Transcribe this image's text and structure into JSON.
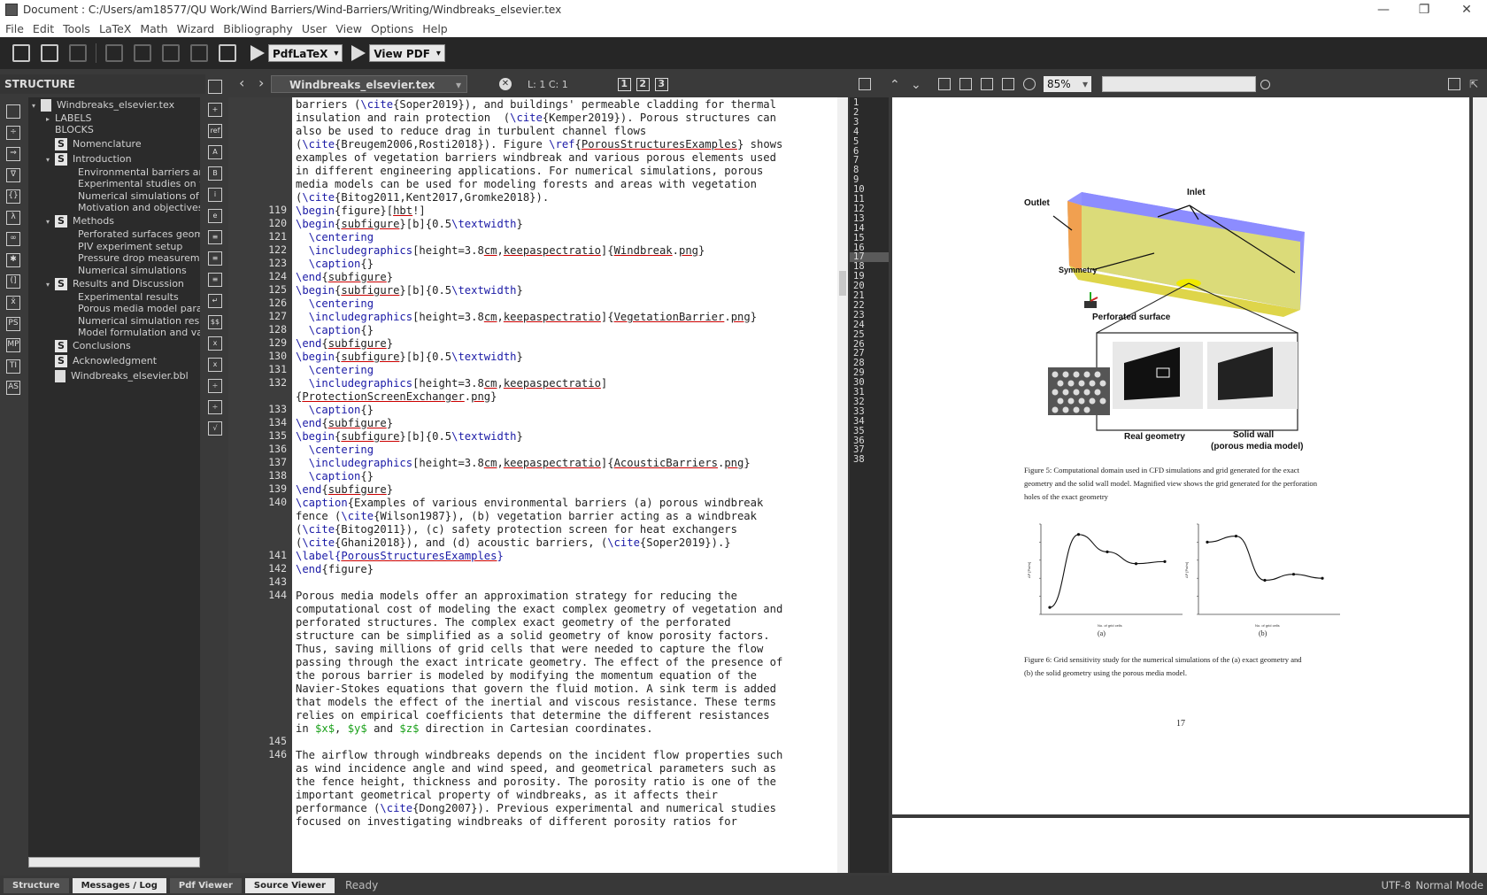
{
  "title_bar": {
    "title": "Document : C:/Users/am18577/QU Work/Wind Barriers/Wind-Barriers/Writing/Windbreaks_elsevier.tex",
    "minimize": "—",
    "maximize": "❐",
    "close": "✕"
  },
  "menu": [
    "File",
    "Edit",
    "Tools",
    "LaTeX",
    "Math",
    "Wizard",
    "Bibliography",
    "User",
    "View",
    "Options",
    "Help"
  ],
  "toolbar": {
    "compiler": "PdfLaTeX",
    "viewer": "View PDF"
  },
  "structure": {
    "header": "STRUCTURE",
    "items": [
      {
        "label": "Windbreaks_elsevier.tex",
        "kind": "file",
        "level": 0,
        "arrow": "▾"
      },
      {
        "label": "LABELS",
        "kind": "plain",
        "level": 1,
        "arrow": "▸"
      },
      {
        "label": "BLOCKS",
        "kind": "plain",
        "level": 1,
        "arrow": ""
      },
      {
        "label": "Nomenclature",
        "kind": "section",
        "level": 1,
        "arrow": ""
      },
      {
        "label": "Introduction",
        "kind": "section",
        "level": 1,
        "arrow": "▾"
      },
      {
        "label": "Environmental barriers and",
        "kind": "sub",
        "level": 2
      },
      {
        "label": "Experimental studies on w",
        "kind": "sub",
        "level": 2
      },
      {
        "label": "Numerical simulations of w",
        "kind": "sub",
        "level": 2
      },
      {
        "label": "Motivation and objectives",
        "kind": "sub",
        "level": 2
      },
      {
        "label": "Methods",
        "kind": "section",
        "level": 1,
        "arrow": "▾"
      },
      {
        "label": "Perforated surfaces geome",
        "kind": "sub",
        "level": 2
      },
      {
        "label": "PIV experiment setup",
        "kind": "sub",
        "level": 2
      },
      {
        "label": "Pressure drop measuremen",
        "kind": "sub",
        "level": 2
      },
      {
        "label": "Numerical simulations",
        "kind": "sub",
        "level": 2
      },
      {
        "label": "Results and Discussion",
        "kind": "section",
        "level": 1,
        "arrow": "▾"
      },
      {
        "label": "Experimental results",
        "kind": "sub",
        "level": 2
      },
      {
        "label": "Porous media model paran",
        "kind": "sub",
        "level": 2
      },
      {
        "label": "Numerical simulation resul",
        "kind": "sub",
        "level": 2
      },
      {
        "label": "Model formulation and vali",
        "kind": "sub",
        "level": 2
      },
      {
        "label": "Conclusions",
        "kind": "section",
        "level": 1,
        "arrow": ""
      },
      {
        "label": "Acknowledgment",
        "kind": "section",
        "level": 1,
        "arrow": ""
      },
      {
        "label": "Windbreaks_elsevier.bbl",
        "kind": "bbl",
        "level": 1,
        "arrow": ""
      }
    ]
  },
  "editor": {
    "tab": "Windbreaks_elsevier.tex",
    "cursor": "L: 1 C: 1",
    "view_buttons": [
      "1",
      "2",
      "3"
    ],
    "lines": [
      {
        "n": "",
        "t": "barriers (\\cite{Soper2019}), and buildings' permeable cladding for thermal"
      },
      {
        "n": "",
        "t": "insulation and rain protection  (\\cite{Kemper2019}). Porous structures can"
      },
      {
        "n": "",
        "t": "also be used to reduce drag in turbulent channel flows"
      },
      {
        "n": "",
        "t": "(\\cite{Breugem2006,Rosti2018}). Figure \\ref{PorousStructuresExamples} shows"
      },
      {
        "n": "",
        "t": "examples of vegetation barriers windbreak and various porous elements used"
      },
      {
        "n": "",
        "t": "in different engineering applications. For numerical simulations, porous"
      },
      {
        "n": "",
        "t": "media models can be used for modeling forests and areas with vegetation"
      },
      {
        "n": "",
        "t": "(\\cite{Bitog2011,Kent2017,Gromke2018})."
      },
      {
        "n": "119",
        "t": "\\begin{figure}[hbt!]"
      },
      {
        "n": "120",
        "t": "\\begin{subfigure}[b]{0.5\\textwidth}"
      },
      {
        "n": "121",
        "t": "  \\centering"
      },
      {
        "n": "122",
        "t": "  \\includegraphics[height=3.8cm,keepaspectratio]{Windbreak.png}"
      },
      {
        "n": "123",
        "t": "  \\caption{}"
      },
      {
        "n": "124",
        "t": "\\end{subfigure}"
      },
      {
        "n": "125",
        "t": "\\begin{subfigure}[b]{0.5\\textwidth}"
      },
      {
        "n": "126",
        "t": "  \\centering"
      },
      {
        "n": "127",
        "t": "  \\includegraphics[height=3.8cm,keepaspectratio]{VegetationBarrier.png}"
      },
      {
        "n": "128",
        "t": "  \\caption{}"
      },
      {
        "n": "129",
        "t": "\\end{subfigure}"
      },
      {
        "n": "130",
        "t": "\\begin{subfigure}[b]{0.5\\textwidth}"
      },
      {
        "n": "131",
        "t": "  \\centering"
      },
      {
        "n": "132",
        "t": "  \\includegraphics[height=3.8cm,keepaspectratio]"
      },
      {
        "n": "",
        "t": "{ProtectionScreenExchanger.png}"
      },
      {
        "n": "133",
        "t": "  \\caption{}"
      },
      {
        "n": "134",
        "t": "\\end{subfigure}"
      },
      {
        "n": "135",
        "t": "\\begin{subfigure}[b]{0.5\\textwidth}"
      },
      {
        "n": "136",
        "t": "  \\centering"
      },
      {
        "n": "137",
        "t": "  \\includegraphics[height=3.8cm,keepaspectratio]{AcousticBarriers.png}"
      },
      {
        "n": "138",
        "t": "  \\caption{}"
      },
      {
        "n": "139",
        "t": "\\end{subfigure}"
      },
      {
        "n": "140",
        "t": "\\caption{Examples of various environmental barriers (a) porous windbreak"
      },
      {
        "n": "",
        "t": "fence (\\cite{Wilson1987}), (b) vegetation barrier acting as a windbreak"
      },
      {
        "n": "",
        "t": "(\\cite{Bitog2011}), (c) safety protection screen for heat exchangers"
      },
      {
        "n": "",
        "t": "(\\cite{Ghani2018}), and (d) acoustic barriers, (\\cite{Soper2019}).}"
      },
      {
        "n": "141",
        "t": "\\label{PorousStructuresExamples}"
      },
      {
        "n": "142",
        "t": "\\end{figure}"
      },
      {
        "n": "143",
        "t": ""
      },
      {
        "n": "144",
        "t": "Porous media models offer an approximation strategy for reducing the"
      },
      {
        "n": "",
        "t": "computational cost of modeling the exact complex geometry of vegetation and"
      },
      {
        "n": "",
        "t": "perforated structures. The complex exact geometry of the perforated"
      },
      {
        "n": "",
        "t": "structure can be simplified as a solid geometry of know porosity factors."
      },
      {
        "n": "",
        "t": "Thus, saving millions of grid cells that were needed to capture the flow"
      },
      {
        "n": "",
        "t": "passing through the exact intricate geometry. The effect of the presence of"
      },
      {
        "n": "",
        "t": "the porous barrier is modeled by modifying the momentum equation of the"
      },
      {
        "n": "",
        "t": "Navier-Stokes equations that govern the fluid motion. A sink term is added"
      },
      {
        "n": "",
        "t": "that models the effect of the inertial and viscous resistance. These terms"
      },
      {
        "n": "",
        "t": "relies on empirical coefficients that determine the different resistances"
      },
      {
        "n": "",
        "t": "in $x$, $y$ and $z$ direction in Cartesian coordinates."
      },
      {
        "n": "145",
        "t": ""
      },
      {
        "n": "146",
        "t": "The airflow through windbreaks depends on the incident flow properties such"
      },
      {
        "n": "",
        "t": "as wind incidence angle and wind speed, and geometrical parameters such as"
      },
      {
        "n": "",
        "t": "the fence height, thickness and porosity. The porosity ratio is one of the"
      },
      {
        "n": "",
        "t": "important geometrical property of windbreaks, as it affects their"
      },
      {
        "n": "",
        "t": "performance (\\cite{Dong2007}). Previous experimental and numerical studies"
      },
      {
        "n": "",
        "t": "focused on investigating windbreaks of different porosity ratios for"
      }
    ]
  },
  "pdf": {
    "zoom": "85%",
    "search_value": "",
    "minimap_lines": [
      "1",
      "2",
      "3",
      "4",
      "5",
      "6",
      "7",
      "8",
      "9",
      "10",
      "11",
      "12",
      "13",
      "14",
      "15",
      "16",
      "17",
      "18",
      "19",
      "20",
      "21",
      "22",
      "23",
      "24",
      "25",
      "26",
      "27",
      "28",
      "29",
      "30",
      "31",
      "32",
      "33",
      "34",
      "35",
      "36",
      "37",
      "38"
    ],
    "highlight_line": "17",
    "figure5": {
      "outlet": "Outlet",
      "inlet": "Inlet",
      "symmetry": "Symmetry",
      "perforated": "Perforated surface",
      "real": "Real geometry",
      "solid1": "Solid wall",
      "solid2": "(porous media model)"
    },
    "caption5": [
      "Figure 5:  Computational domain used in CFD simulations and grid generated for the exact",
      "geometry and the solid wall model. Magnified view shows the grid generated for the perforation",
      "holes of the exact geometry"
    ],
    "sublabel_a": "(a)",
    "sublabel_b": "(b)",
    "caption6": [
      "Figure 6:  Grid sensitivity study for the numerical simulations of the (a) exact geometry and",
      "(b) the solid geometry using the porous media model."
    ],
    "page_number": "17"
  },
  "chart_data": [
    {
      "type": "line",
      "x": [
        0,
        1,
        2,
        3,
        4
      ],
      "values": [
        1.13,
        1.235,
        1.21,
        1.193,
        1.196
      ],
      "ylim": [
        1.12,
        1.25
      ],
      "xlabel": "No. of grid cells",
      "ylabel": "ΔP [Pa/m]"
    },
    {
      "type": "line",
      "x": [
        0,
        1,
        2,
        3,
        4
      ],
      "values": [
        0.51,
        0.54,
        0.32,
        0.35,
        0.33
      ],
      "ylim": [
        0.15,
        0.6
      ],
      "xlabel": "No. of grid cells",
      "ylabel": "ΔP [Pa/m]"
    }
  ],
  "status": {
    "tabs": [
      "Structure",
      "Messages / Log",
      "Pdf Viewer",
      "Source Viewer"
    ],
    "active": "Source Viewer",
    "ready": "Ready",
    "encoding": "UTF-8",
    "mode": "Normal Mode"
  }
}
